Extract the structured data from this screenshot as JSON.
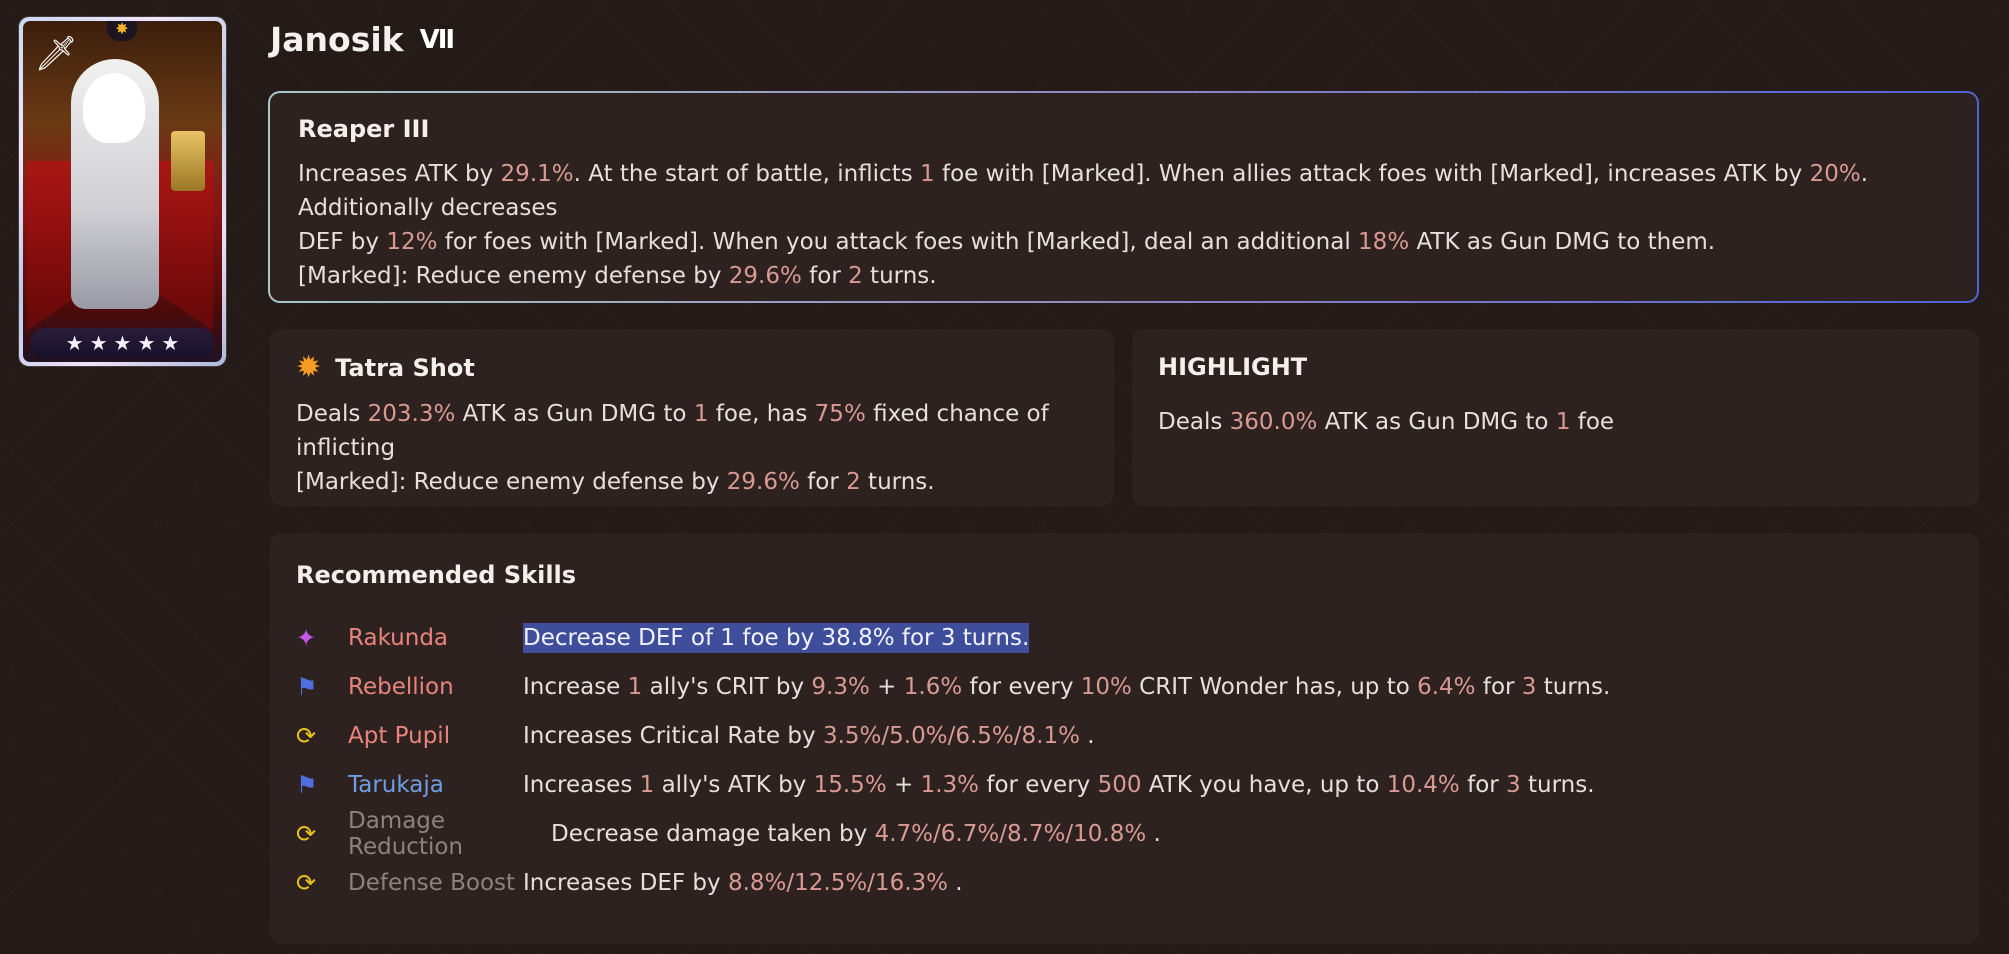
{
  "character": {
    "name": "Janosik",
    "rank_label": "VII",
    "stars": [
      "★",
      "★",
      "★",
      "★",
      "★"
    ]
  },
  "weapon": {
    "title": "Reaper III",
    "lines": [
      [
        {
          "t": "Increases ATK by ",
          "h": false
        },
        {
          "t": "29.1%",
          "h": true
        },
        {
          "t": ". At the start of battle, inflicts ",
          "h": false
        },
        {
          "t": "1",
          "h": true
        },
        {
          "t": " foe with [Marked]. When allies attack foes with [Marked], increases ATK by ",
          "h": false
        },
        {
          "t": "20%",
          "h": true
        },
        {
          "t": ". Additionally decreases",
          "h": false
        }
      ],
      [
        {
          "t": "DEF by ",
          "h": false
        },
        {
          "t": "12%",
          "h": true
        },
        {
          "t": " for foes with [Marked]. When you attack foes with [Marked], deal an additional ",
          "h": false
        },
        {
          "t": "18%",
          "h": true
        },
        {
          "t": " ATK as Gun DMG to them.",
          "h": false
        }
      ],
      [
        {
          "t": "[Marked]: Reduce enemy defense by ",
          "h": false
        },
        {
          "t": "29.6%",
          "h": true
        },
        {
          "t": " for ",
          "h": false
        },
        {
          "t": "2",
          "h": true
        },
        {
          "t": " turns.",
          "h": false
        }
      ]
    ]
  },
  "skill": {
    "title": "Tatra Shot",
    "lines": [
      [
        {
          "t": "Deals ",
          "h": false
        },
        {
          "t": "203.3%",
          "h": true
        },
        {
          "t": " ATK as Gun DMG to ",
          "h": false
        },
        {
          "t": "1",
          "h": true
        },
        {
          "t": " foe, has ",
          "h": false
        },
        {
          "t": "75%",
          "h": true
        },
        {
          "t": " fixed chance of inflicting",
          "h": false
        }
      ],
      [
        {
          "t": "[Marked]: Reduce enemy defense by ",
          "h": false
        },
        {
          "t": "29.6%",
          "h": true
        },
        {
          "t": " for ",
          "h": false
        },
        {
          "t": "2",
          "h": true
        },
        {
          "t": " turns.",
          "h": false
        }
      ]
    ]
  },
  "highlight": {
    "title": "HIGHLIGHT",
    "lines": [
      [
        {
          "t": "Deals ",
          "h": false
        },
        {
          "t": "360.0%",
          "h": true
        },
        {
          "t": " ATK as Gun DMG to ",
          "h": false
        },
        {
          "t": "1",
          "h": true
        },
        {
          "t": " foe",
          "h": false
        }
      ]
    ]
  },
  "recommended": {
    "title": "Recommended Skills",
    "items": [
      {
        "icon": "nuclear-icon",
        "glyph": "✦",
        "icon_color": "#c158e8",
        "name": "Rakunda",
        "name_color": "#e8847c",
        "selected": true,
        "desc": [
          {
            "t": "Decrease DEF of 1 foe by 38.8% for 3 turns.",
            "h": false
          }
        ]
      },
      {
        "icon": "support-flag-icon",
        "glyph": "⚑",
        "icon_color": "#4f6fe0",
        "name": "Rebellion",
        "name_color": "#e8847c",
        "selected": false,
        "desc": [
          {
            "t": "Increase ",
            "h": false
          },
          {
            "t": "1",
            "h": true
          },
          {
            "t": " ally's CRIT by ",
            "h": false
          },
          {
            "t": "9.3%",
            "h": true
          },
          {
            "t": " + ",
            "h": false
          },
          {
            "t": "1.6%",
            "h": true
          },
          {
            "t": " for every ",
            "h": false
          },
          {
            "t": "10%",
            "h": true
          },
          {
            "t": " CRIT Wonder has, up to ",
            "h": false
          },
          {
            "t": "6.4%",
            "h": true
          },
          {
            "t": " for ",
            "h": false
          },
          {
            "t": "3",
            "h": true
          },
          {
            "t": " turns.",
            "h": false
          }
        ]
      },
      {
        "icon": "passive-swirl-icon",
        "glyph": "⟳",
        "icon_color": "#e8c21c",
        "name": "Apt Pupil",
        "name_color": "#e8847c",
        "selected": false,
        "desc": [
          {
            "t": "Increases Critical Rate by ",
            "h": false
          },
          {
            "t": "3.5%/5.0%/6.5%/8.1%",
            "h": true
          },
          {
            "t": " .",
            "h": false
          }
        ]
      },
      {
        "icon": "support-flag-icon",
        "glyph": "⚑",
        "icon_color": "#4f6fe0",
        "name": "Tarukaja",
        "name_color": "#6f9ee0",
        "selected": false,
        "desc": [
          {
            "t": "Increases ",
            "h": false
          },
          {
            "t": "1",
            "h": true
          },
          {
            "t": " ally's ATK by ",
            "h": false
          },
          {
            "t": "15.5%",
            "h": true
          },
          {
            "t": " + ",
            "h": false
          },
          {
            "t": "1.3%",
            "h": true
          },
          {
            "t": " for every ",
            "h": false
          },
          {
            "t": "500",
            "h": true
          },
          {
            "t": " ATK you have, up to ",
            "h": false
          },
          {
            "t": "10.4%",
            "h": true
          },
          {
            "t": " for ",
            "h": false
          },
          {
            "t": "3",
            "h": true
          },
          {
            "t": " turns.",
            "h": false
          }
        ]
      },
      {
        "icon": "passive-swirl-icon",
        "glyph": "⟳",
        "icon_color": "#e8c21c",
        "name": "Damage Reduction",
        "name_color": "#8c8380",
        "selected": false,
        "desc": [
          {
            "t": "Decrease damage taken by ",
            "h": false
          },
          {
            "t": "4.7%/6.7%/8.7%/10.8%",
            "h": true
          },
          {
            "t": " .",
            "h": false
          }
        ]
      },
      {
        "icon": "passive-swirl-icon",
        "glyph": "⟳",
        "icon_color": "#e8c21c",
        "name": "Defense Boost",
        "name_color": "#8c8380",
        "selected": false,
        "desc": [
          {
            "t": "Increases DEF by ",
            "h": false
          },
          {
            "t": "8.8%/12.5%/16.3%",
            "h": true
          },
          {
            "t": " .",
            "h": false
          }
        ]
      }
    ]
  }
}
